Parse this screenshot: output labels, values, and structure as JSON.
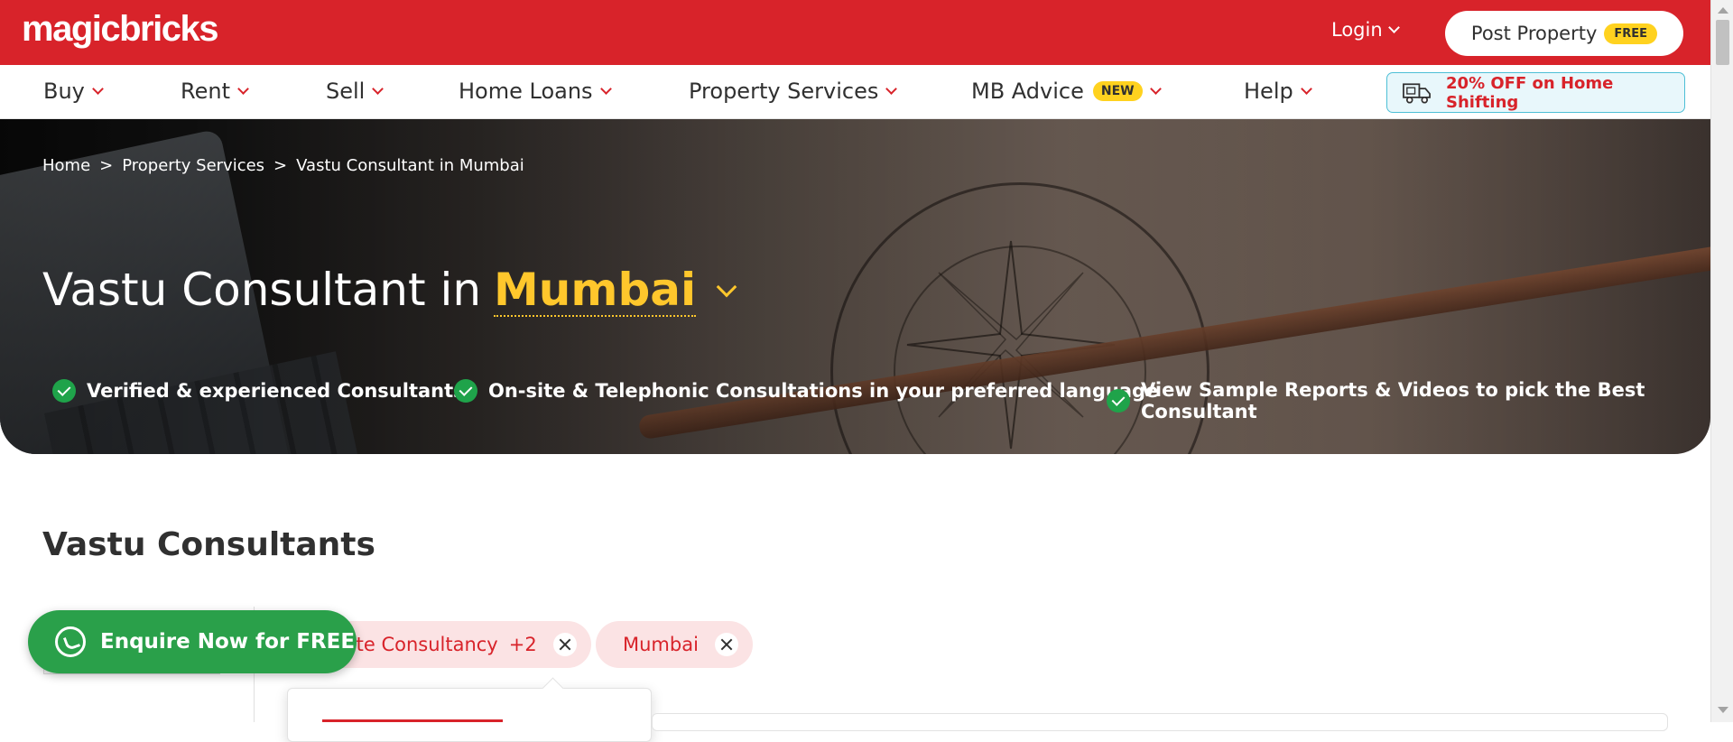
{
  "header": {
    "logo_text": "magicbricks",
    "login_label": "Login",
    "post_property_label": "Post Property",
    "post_property_badge": "FREE"
  },
  "nav": {
    "items": [
      {
        "label": "Buy"
      },
      {
        "label": "Rent"
      },
      {
        "label": "Sell"
      },
      {
        "label": "Home Loans"
      },
      {
        "label": "Property Services"
      },
      {
        "label": "MB Advice",
        "badge": "NEW"
      },
      {
        "label": "Help"
      }
    ],
    "promo_label": "20% OFF on Home Shifting",
    "promo_icon": "truck-icon"
  },
  "hero": {
    "breadcrumb": [
      "Home",
      "Property Services",
      "Vastu Consultant in Mumbai"
    ],
    "breadcrumb_separator": ">",
    "title_prefix": "Vastu Consultant in",
    "city": "Mumbai",
    "features": [
      "Verified & experienced Consultants",
      "On-site & Telephonic Consultations in your preferred language",
      "View Sample Reports & Videos to pick the Best Consultant"
    ]
  },
  "content": {
    "section_title": "Vastu Consultants",
    "filter_chips": [
      {
        "label": "Onsite Consultancy",
        "extra": "+2"
      },
      {
        "label": "Mumbai",
        "extra": ""
      }
    ]
  },
  "enquire_label": "Enquire Now for FREE",
  "colors": {
    "brand_red": "#d8232a",
    "accent_yellow": "#ffc72c",
    "whatsapp_green": "#2aa04a",
    "check_green": "#1fa34a"
  }
}
